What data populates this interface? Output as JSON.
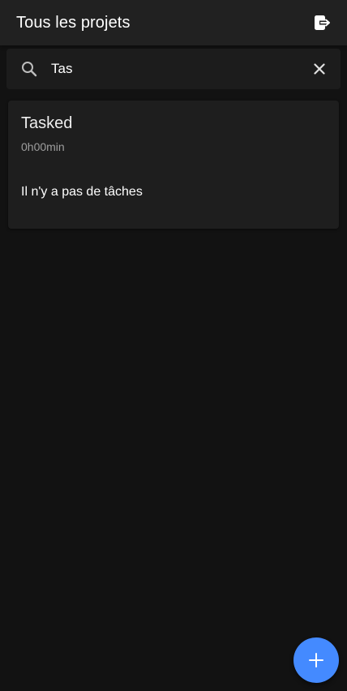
{
  "app_bar": {
    "title": "Tous les projets",
    "logout_icon": "logout-icon"
  },
  "search": {
    "value": "Tas",
    "search_icon": "search-icon",
    "clear_icon": "close-icon"
  },
  "projects": [
    {
      "name": "Tasked",
      "time": "0h00min",
      "empty_message": "Il n'y a pas de tâches"
    }
  ],
  "fab": {
    "icon": "plus-icon"
  },
  "colors": {
    "background": "#121212",
    "app_bar": "#212121",
    "card": "#1e1e1e",
    "accent": "#448aff",
    "muted_text": "#9e9e9e"
  }
}
